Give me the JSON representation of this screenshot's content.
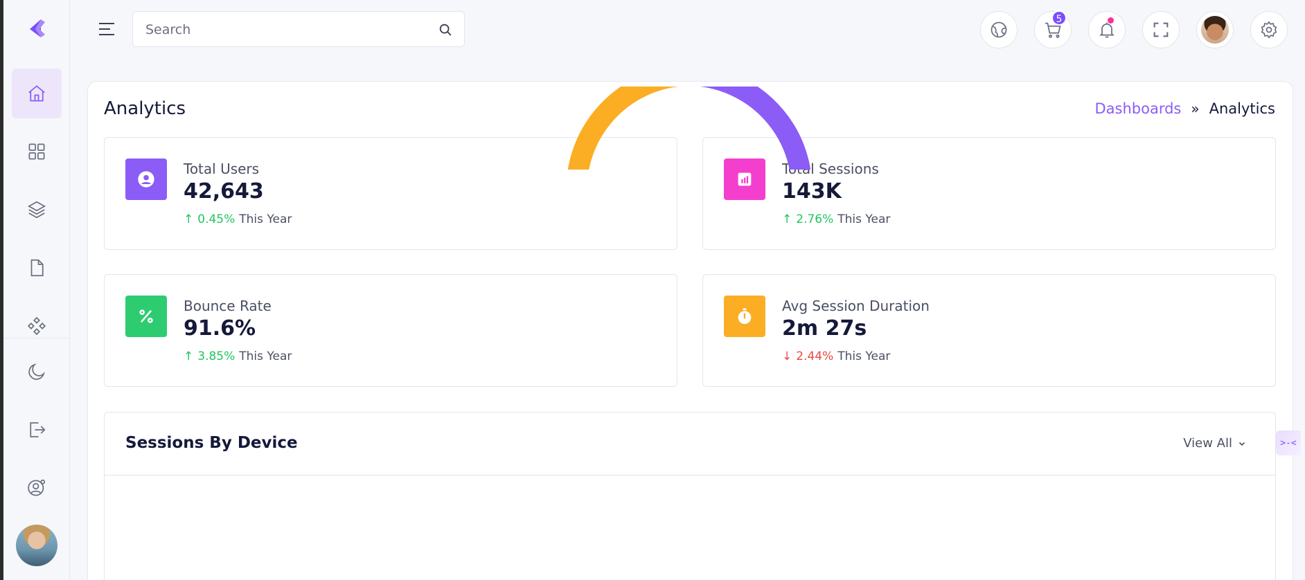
{
  "header": {
    "search_placeholder": "Search",
    "cart_count": "5"
  },
  "sidebar": {
    "items": [
      {
        "icon": "home-icon",
        "active": true
      },
      {
        "icon": "grid-icon",
        "active": false
      },
      {
        "icon": "layers-icon",
        "active": false
      },
      {
        "icon": "file-icon",
        "active": false
      },
      {
        "icon": "diamond-grid-icon",
        "active": false
      },
      {
        "icon": "moon-icon",
        "active": false
      },
      {
        "icon": "logout-icon",
        "active": false
      },
      {
        "icon": "user-settings-icon",
        "active": false
      }
    ]
  },
  "page": {
    "title": "Analytics",
    "breadcrumb": {
      "parent": "Dashboards",
      "separator": "»",
      "current": "Analytics"
    }
  },
  "stats": [
    {
      "label": "Total Users",
      "value": "42,643",
      "change": "0.45%",
      "direction": "up",
      "period": "This Year",
      "icon": "user-circle-icon",
      "color": "#8b5cf6"
    },
    {
      "label": "Total Sessions",
      "value": "143K",
      "change": "2.76%",
      "direction": "up",
      "period": "This Year",
      "icon": "chart-bar-icon",
      "color": "#f43fce"
    },
    {
      "label": "Bounce Rate",
      "value": "91.6%",
      "change": "3.85%",
      "direction": "up",
      "period": "This Year",
      "icon": "percent-icon",
      "color": "#2ecc71"
    },
    {
      "label": "Avg Session Duration",
      "value": "2m 27s",
      "change": "2.44%",
      "direction": "down",
      "period": "This Year",
      "icon": "stopwatch-icon",
      "color": "#fbae24"
    }
  ],
  "sessions": {
    "title": "Sessions By Device",
    "view_all": "View All"
  },
  "colors": {
    "accent": "#8b5cf6",
    "up": "#22c55e",
    "down": "#ef4444",
    "donut_orange": "#fbae24",
    "donut_purple": "#8b5cf6"
  }
}
